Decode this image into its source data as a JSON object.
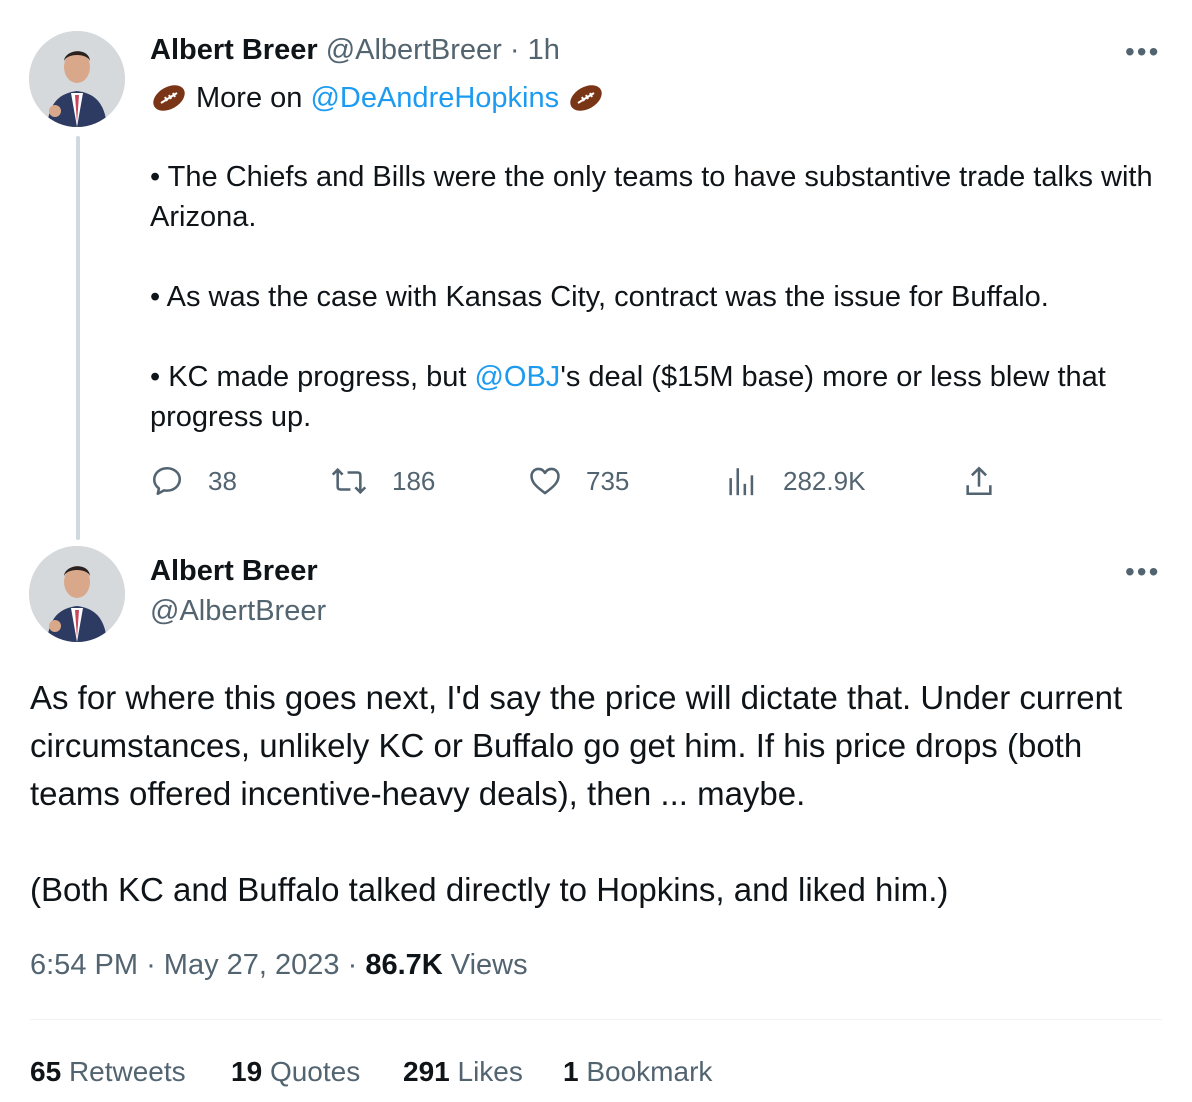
{
  "tweet1": {
    "name": "Albert Breer",
    "handle": "@AlbertBreer",
    "separator": "·",
    "time": "1h",
    "line1_prefix": "More on",
    "line1_mention": "@DeAndreHopkins",
    "bullet1": "• The Chiefs and Bills were the only teams to have substantive trade talks with Arizona.",
    "bullet2": "• As was the case with Kansas City, contract was the issue for Buffalo.",
    "bullet3_prefix": "• KC made progress, but ",
    "bullet3_mention": "@OBJ",
    "bullet3_suffix": "'s deal ($15M base) more or less blew that progress up.",
    "replies": "38",
    "retweets": "186",
    "likes": "735",
    "views": "282.9K"
  },
  "tweet2": {
    "name": "Albert Breer",
    "handle": "@AlbertBreer",
    "paragraph1": "As for where this goes next, I'd say the price will dictate that. Under current circumstances, unlikely KC or Buffalo go get him. If his price drops (both teams offered incentive-heavy deals), then ... maybe.",
    "paragraph2": "(Both KC and Buffalo talked directly to Hopkins, and liked him.)",
    "time": "6:54 PM",
    "date": "May 27, 2023",
    "views_count": "86.7K",
    "views_label": "Views",
    "sep": "·"
  },
  "stats": {
    "retweets_count": "65",
    "retweets_label": "Retweets",
    "quotes_count": "19",
    "quotes_label": "Quotes",
    "likes_count": "291",
    "likes_label": "Likes",
    "bookmarks_count": "1",
    "bookmarks_label": "Bookmark"
  },
  "icons": [
    "football-icon",
    "reply-icon",
    "retweet-icon",
    "like-icon",
    "views-icon",
    "share-icon",
    "more-icon"
  ],
  "colors": {
    "link": "#1d9bf0",
    "muted": "#536471",
    "text": "#0f1419",
    "thread_line": "#cfd9de"
  }
}
